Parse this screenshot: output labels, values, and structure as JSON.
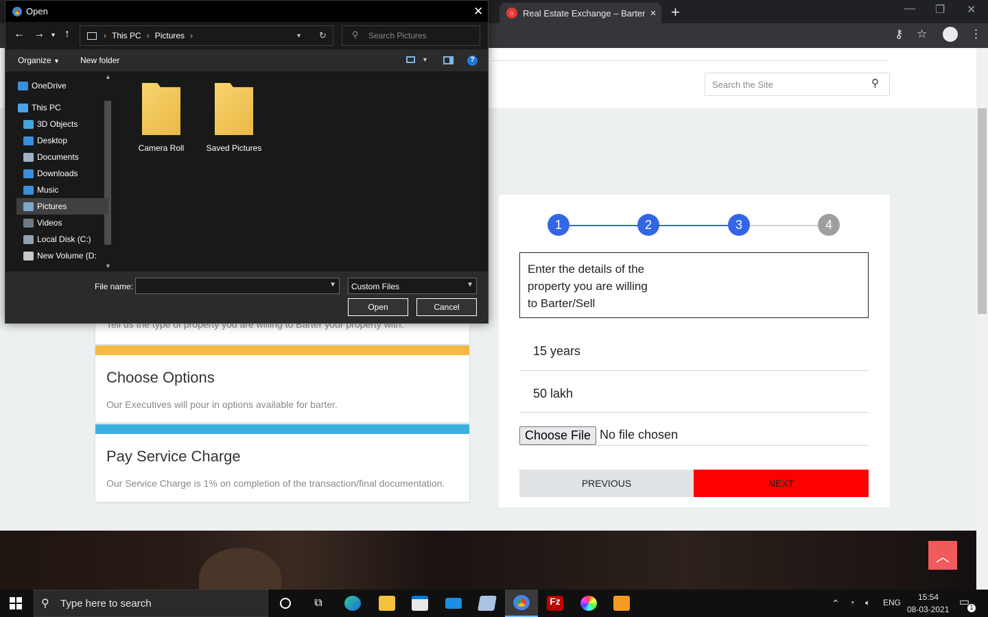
{
  "browser": {
    "tab_title": "Real Estate Exchange – Barter or",
    "tab_close": "×",
    "new_tab": "+"
  },
  "site": {
    "search_placeholder": "Search the Site"
  },
  "cards": [
    {
      "title": "",
      "text": "Tell us the type of property you are willing to Barter your property with.",
      "color": "#f5b940"
    },
    {
      "title": "Choose Options",
      "text": "Our Executives will pour in options available for barter.",
      "color": "#f5b940"
    },
    {
      "title": "Pay Service Charge",
      "text": "Our Service Charge is 1% on completion of the transaction/final documentation.",
      "color": "#3bb0de"
    }
  ],
  "form": {
    "steps": [
      {
        "label": "1",
        "color": "#3366e6"
      },
      {
        "label": "2",
        "color": "#3366e6"
      },
      {
        "label": "3",
        "color": "#3366e6"
      },
      {
        "label": "4",
        "color": "#9e9e9e"
      }
    ],
    "description": "Enter the details of the property you are willing to Barter/Sell",
    "age_value": "15 years",
    "price_value": "50 lakh",
    "choose_file_label": "Choose File",
    "no_file_text": "No file chosen",
    "previous_label": "PREVIOUS",
    "next_label": "NEXT"
  },
  "dialog": {
    "title": "Open",
    "breadcrumb": [
      "This PC",
      "Pictures"
    ],
    "search_placeholder": "Search Pictures",
    "organize_label": "Organize",
    "new_folder_label": "New folder",
    "tree": [
      {
        "label": "OneDrive",
        "icon": "cloud-icon",
        "color": "#3a8fdc"
      },
      {
        "label": "This PC",
        "icon": "computer-icon",
        "color": "#4aa3e8"
      },
      {
        "label": "3D Objects",
        "icon": "cube-icon",
        "color": "#41a7e0"
      },
      {
        "label": "Desktop",
        "icon": "desktop-icon",
        "color": "#3a8fdc"
      },
      {
        "label": "Documents",
        "icon": "document-icon",
        "color": "#9fb3c8"
      },
      {
        "label": "Downloads",
        "icon": "download-icon",
        "color": "#3a8fdc"
      },
      {
        "label": "Music",
        "icon": "music-icon",
        "color": "#3a8fdc"
      },
      {
        "label": "Pictures",
        "icon": "picture-icon",
        "color": "#7fa7cc"
      },
      {
        "label": "Videos",
        "icon": "video-icon",
        "color": "#6f7a86"
      },
      {
        "label": "Local Disk (C:)",
        "icon": "disk-icon",
        "color": "#8fa2b4"
      },
      {
        "label": "New Volume (D:",
        "icon": "disk-icon",
        "color": "#c9c9c9"
      }
    ],
    "folders": [
      "Camera Roll",
      "Saved Pictures"
    ],
    "file_name_label": "File name:",
    "file_type": "Custom Files",
    "open_label": "Open",
    "cancel_label": "Cancel"
  },
  "taskbar": {
    "search_placeholder": "Type here to search",
    "language": "ENG",
    "time": "15:54",
    "date": "08-03-2021",
    "notification_count": "1"
  }
}
